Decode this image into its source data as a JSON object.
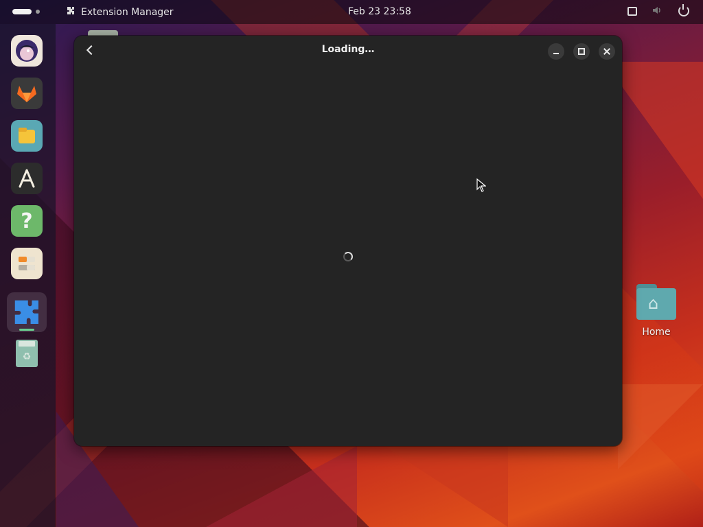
{
  "topbar": {
    "app_name": "Extension Manager",
    "clock": "Feb 23  23:58",
    "tray_icons": [
      "screen-icon",
      "volume-icon",
      "power-icon"
    ]
  },
  "dock": {
    "items": [
      {
        "name": "bird-app-icon"
      },
      {
        "name": "gitlab-fox-icon"
      },
      {
        "name": "files-icon"
      },
      {
        "name": "software-store-icon"
      },
      {
        "name": "help-icon"
      },
      {
        "name": "settings-toggles-icon"
      },
      {
        "name": "extension-manager-icon",
        "active": true
      },
      {
        "name": "trash-icon"
      }
    ]
  },
  "desktop": {
    "home_label": "Home"
  },
  "window": {
    "title": "Loading…",
    "state": "loading"
  },
  "colors": {
    "window_bg": "#242424",
    "accent_indicator": "#6ad08f"
  }
}
